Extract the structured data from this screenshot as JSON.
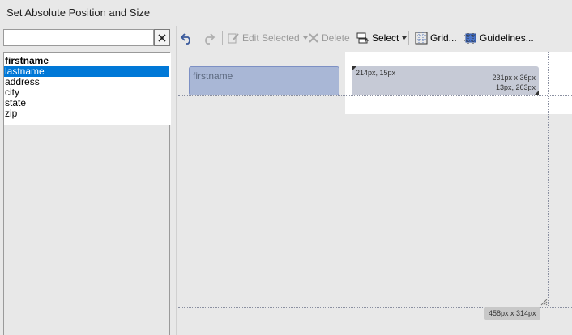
{
  "window": {
    "title": "Set Absolute Position and Size"
  },
  "filter": {
    "placeholder": "",
    "value": "",
    "clear_glyph": "✕"
  },
  "fields": [
    {
      "label": "firstname",
      "style": "bold"
    },
    {
      "label": "lastname",
      "style": "selected"
    },
    {
      "label": "address",
      "style": "normal"
    },
    {
      "label": "city",
      "style": "normal"
    },
    {
      "label": "state",
      "style": "normal"
    },
    {
      "label": "zip",
      "style": "normal"
    }
  ],
  "toolbar": {
    "undo_icon": "undo-icon",
    "redo_icon": "redo-icon",
    "edit_selected_label": "Edit Selected",
    "delete_label": "Delete",
    "select_label": "Select",
    "grid_label": "Grid...",
    "guidelines_label": "Guidelines..."
  },
  "canvas": {
    "label_element_text": "firstname",
    "selected_element": {
      "position_text": "214px, 15px",
      "size_text": "231px x 36px",
      "right_bottom_text": "13px, 263px"
    },
    "canvas_size_text": "458px x 314px"
  },
  "colors": {
    "selection": "#0078d7",
    "label_box": "#a9b7d6",
    "selected_box": "#c6cad6"
  }
}
